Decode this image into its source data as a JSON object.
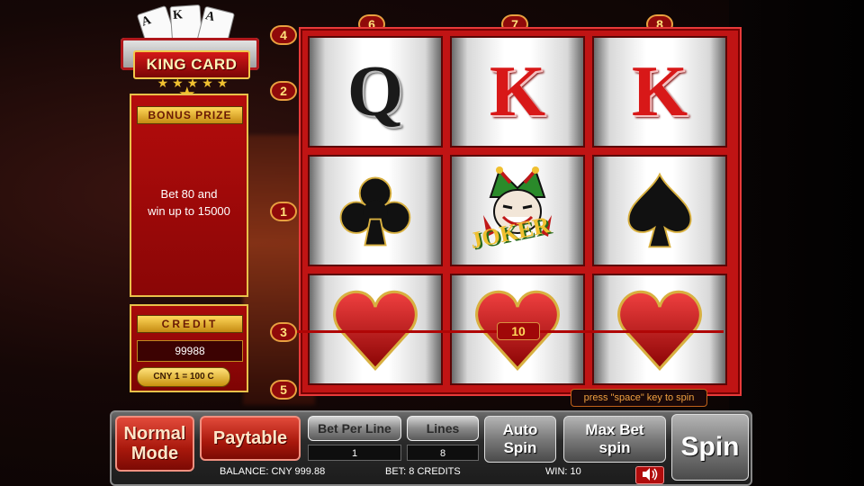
{
  "logo": {
    "title": "KING CARD",
    "cards": [
      "A",
      "K",
      "A"
    ]
  },
  "bonus": {
    "header": "BONUS PRIZE",
    "line1": "Bet 80 and",
    "line2": "win up to 15000"
  },
  "credit": {
    "header": "CREDIT",
    "value": "99988",
    "rate": "CNY 1 = 100 C"
  },
  "line_badges": {
    "top": [
      "6",
      "7",
      "8"
    ],
    "left": [
      "4",
      "2",
      "1",
      "3",
      "5"
    ]
  },
  "reels": [
    [
      {
        "symbol": "Q",
        "kind": "letter",
        "color": "#1a1a1a"
      },
      {
        "symbol": "K",
        "kind": "letter",
        "color": "#d81818"
      },
      {
        "symbol": "K",
        "kind": "letter",
        "color": "#d81818"
      }
    ],
    [
      {
        "symbol": "club",
        "kind": "suit"
      },
      {
        "symbol": "joker",
        "kind": "joker",
        "label": "JOKER"
      },
      {
        "symbol": "spade",
        "kind": "suit"
      }
    ],
    [
      {
        "symbol": "heart",
        "kind": "suit"
      },
      {
        "symbol": "heart",
        "kind": "suit"
      },
      {
        "symbol": "heart",
        "kind": "suit"
      }
    ]
  ],
  "win_line": {
    "line": "3",
    "amount": "10"
  },
  "tooltip": "press \"space\" key to spin",
  "controls": {
    "normal_mode": [
      "Normal",
      "Mode"
    ],
    "paytable": "Paytable",
    "bet_per_line": {
      "label": "Bet Per Line",
      "value": "1"
    },
    "lines": {
      "label": "Lines",
      "value": "8"
    },
    "auto_spin": [
      "Auto",
      "Spin"
    ],
    "max_bet": [
      "Max Bet",
      "spin"
    ],
    "spin": "Spin"
  },
  "status": {
    "balance": "BALANCE: CNY 999.88",
    "bet": "BET: 8 CREDITS",
    "win": "WIN: 10"
  },
  "colors": {
    "frame_red": "#c01414",
    "gold": "#e8c14a",
    "heart_red": "#d81818"
  }
}
